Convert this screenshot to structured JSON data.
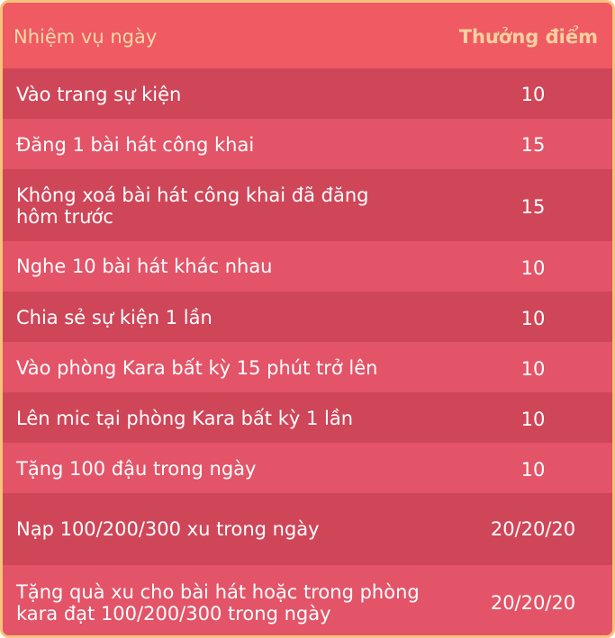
{
  "header": {
    "task_label": "Nhiệm vụ ngày",
    "points_label": "Thưởng điểm"
  },
  "rows": [
    {
      "task": "Vào trang sự kiện",
      "points": "10"
    },
    {
      "task": "Đăng 1 bài hát công khai",
      "points": "15"
    },
    {
      "task": "Không xoá bài hát công khai đã đăng\nhôm trước",
      "points": "15"
    },
    {
      "task": "Nghe 10 bài hát khác nhau",
      "points": "10"
    },
    {
      "task": "Chia sẻ sự kiện 1 lần",
      "points": "10"
    },
    {
      "task": "Vào phòng Kara bất kỳ 15 phút trở lên",
      "points": "10"
    },
    {
      "task": "Lên mic tại phòng Kara bất kỳ 1 lần",
      "points": "10"
    },
    {
      "task": "Tặng 100 đậu trong ngày",
      "points": "10"
    },
    {
      "task": "Nạp 100/200/300 xu trong ngày",
      "points": "20/20/20"
    },
    {
      "task": "Tặng quà xu cho bài hát hoặc trong phòng\nkara đạt 100/200/300 trong ngày",
      "points": "20/20/20"
    }
  ],
  "colors": {
    "header_bg": "#ef5a63",
    "row_dark": "#cf4658",
    "row_light": "#e35468",
    "border": "#f6c27a",
    "header_text": "#fbd8a8"
  }
}
